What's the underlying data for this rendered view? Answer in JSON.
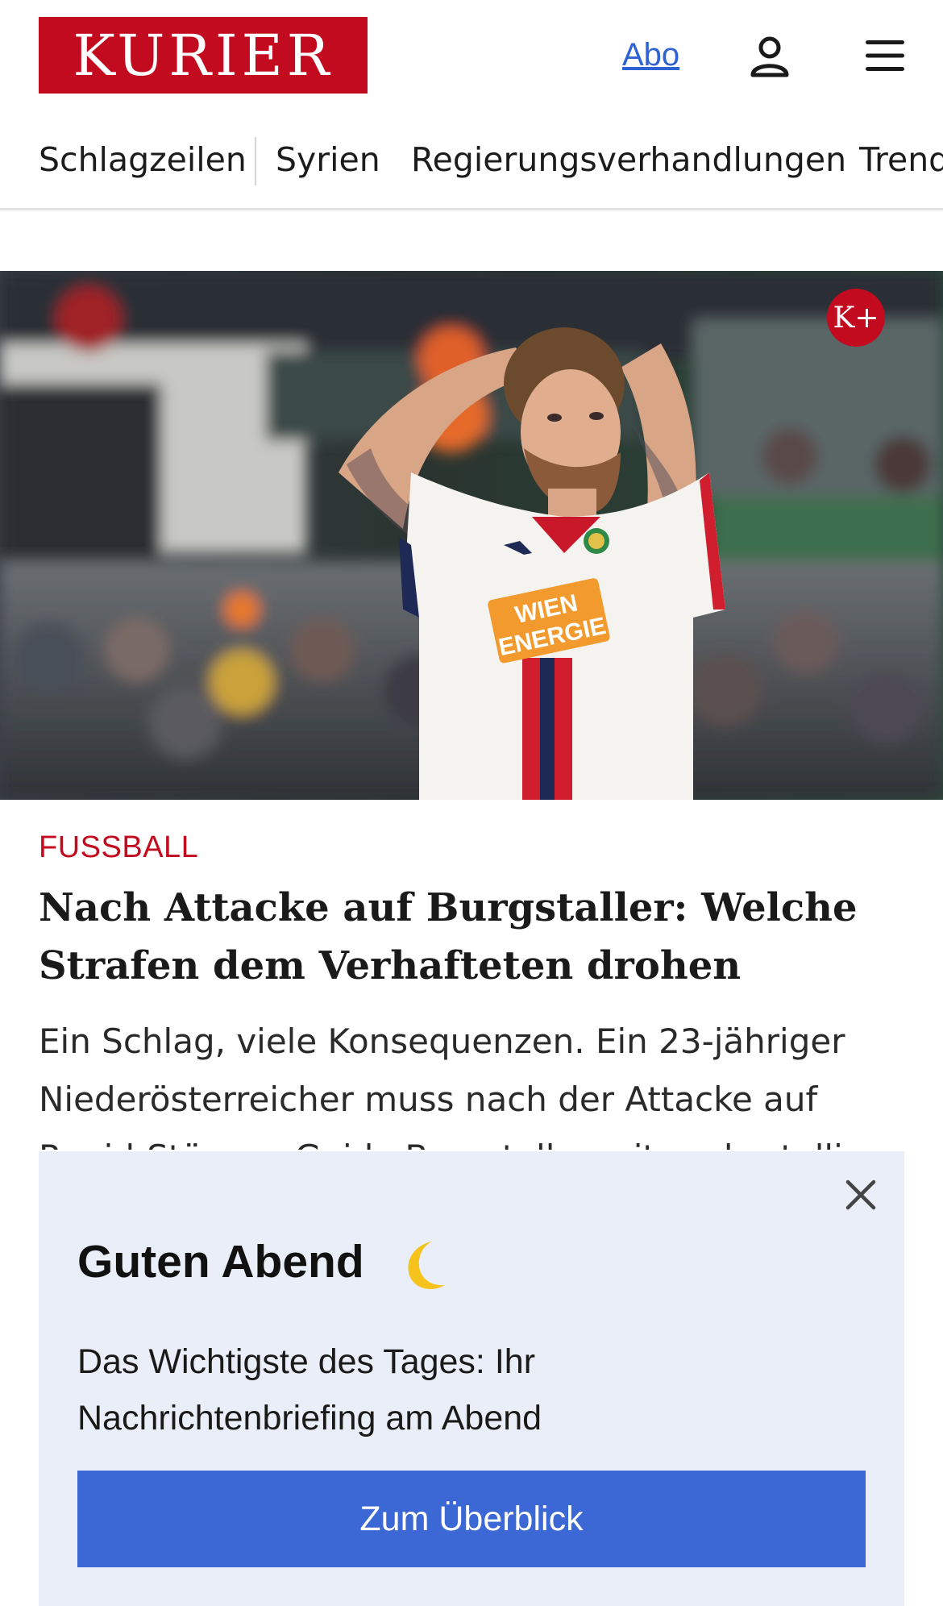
{
  "header": {
    "logo_text": "KURIER",
    "abo_label": "Abo",
    "user_icon": "user-icon",
    "menu_icon": "hamburger-menu-icon",
    "brand_color": "#c30b20"
  },
  "nav": {
    "items": [
      {
        "label": "Schlagzeilen"
      },
      {
        "label": "Syrien"
      },
      {
        "label": "Regierungsverhandlungen"
      },
      {
        "label": "Trends"
      }
    ]
  },
  "article": {
    "badge": "K+",
    "kicker": "FUSSBALL",
    "headline": "Nach Attacke auf Burgstaller: Welche Strafen dem Verhafteten drohen",
    "teaser": "Ein Schlag, viele Konsequenzen. Ein 23-jähriger Niederösterreicher muss nach der Attacke auf Rapid-Stürmer Guido Burgstaller mit sechsstelligen",
    "image_jersey_text": [
      "WIEN",
      "ENERGIE"
    ]
  },
  "overlay": {
    "greeting": "Guten Abend",
    "moon_icon": "crescent-moon-icon",
    "description": "Das Wichtigste des Tages: Ihr Nachrichtenbriefing am Abend",
    "cta_label": "Zum Überblick",
    "close_icon": "close-icon",
    "accent_color": "#3b68d4",
    "background_color": "#eaeef8"
  }
}
